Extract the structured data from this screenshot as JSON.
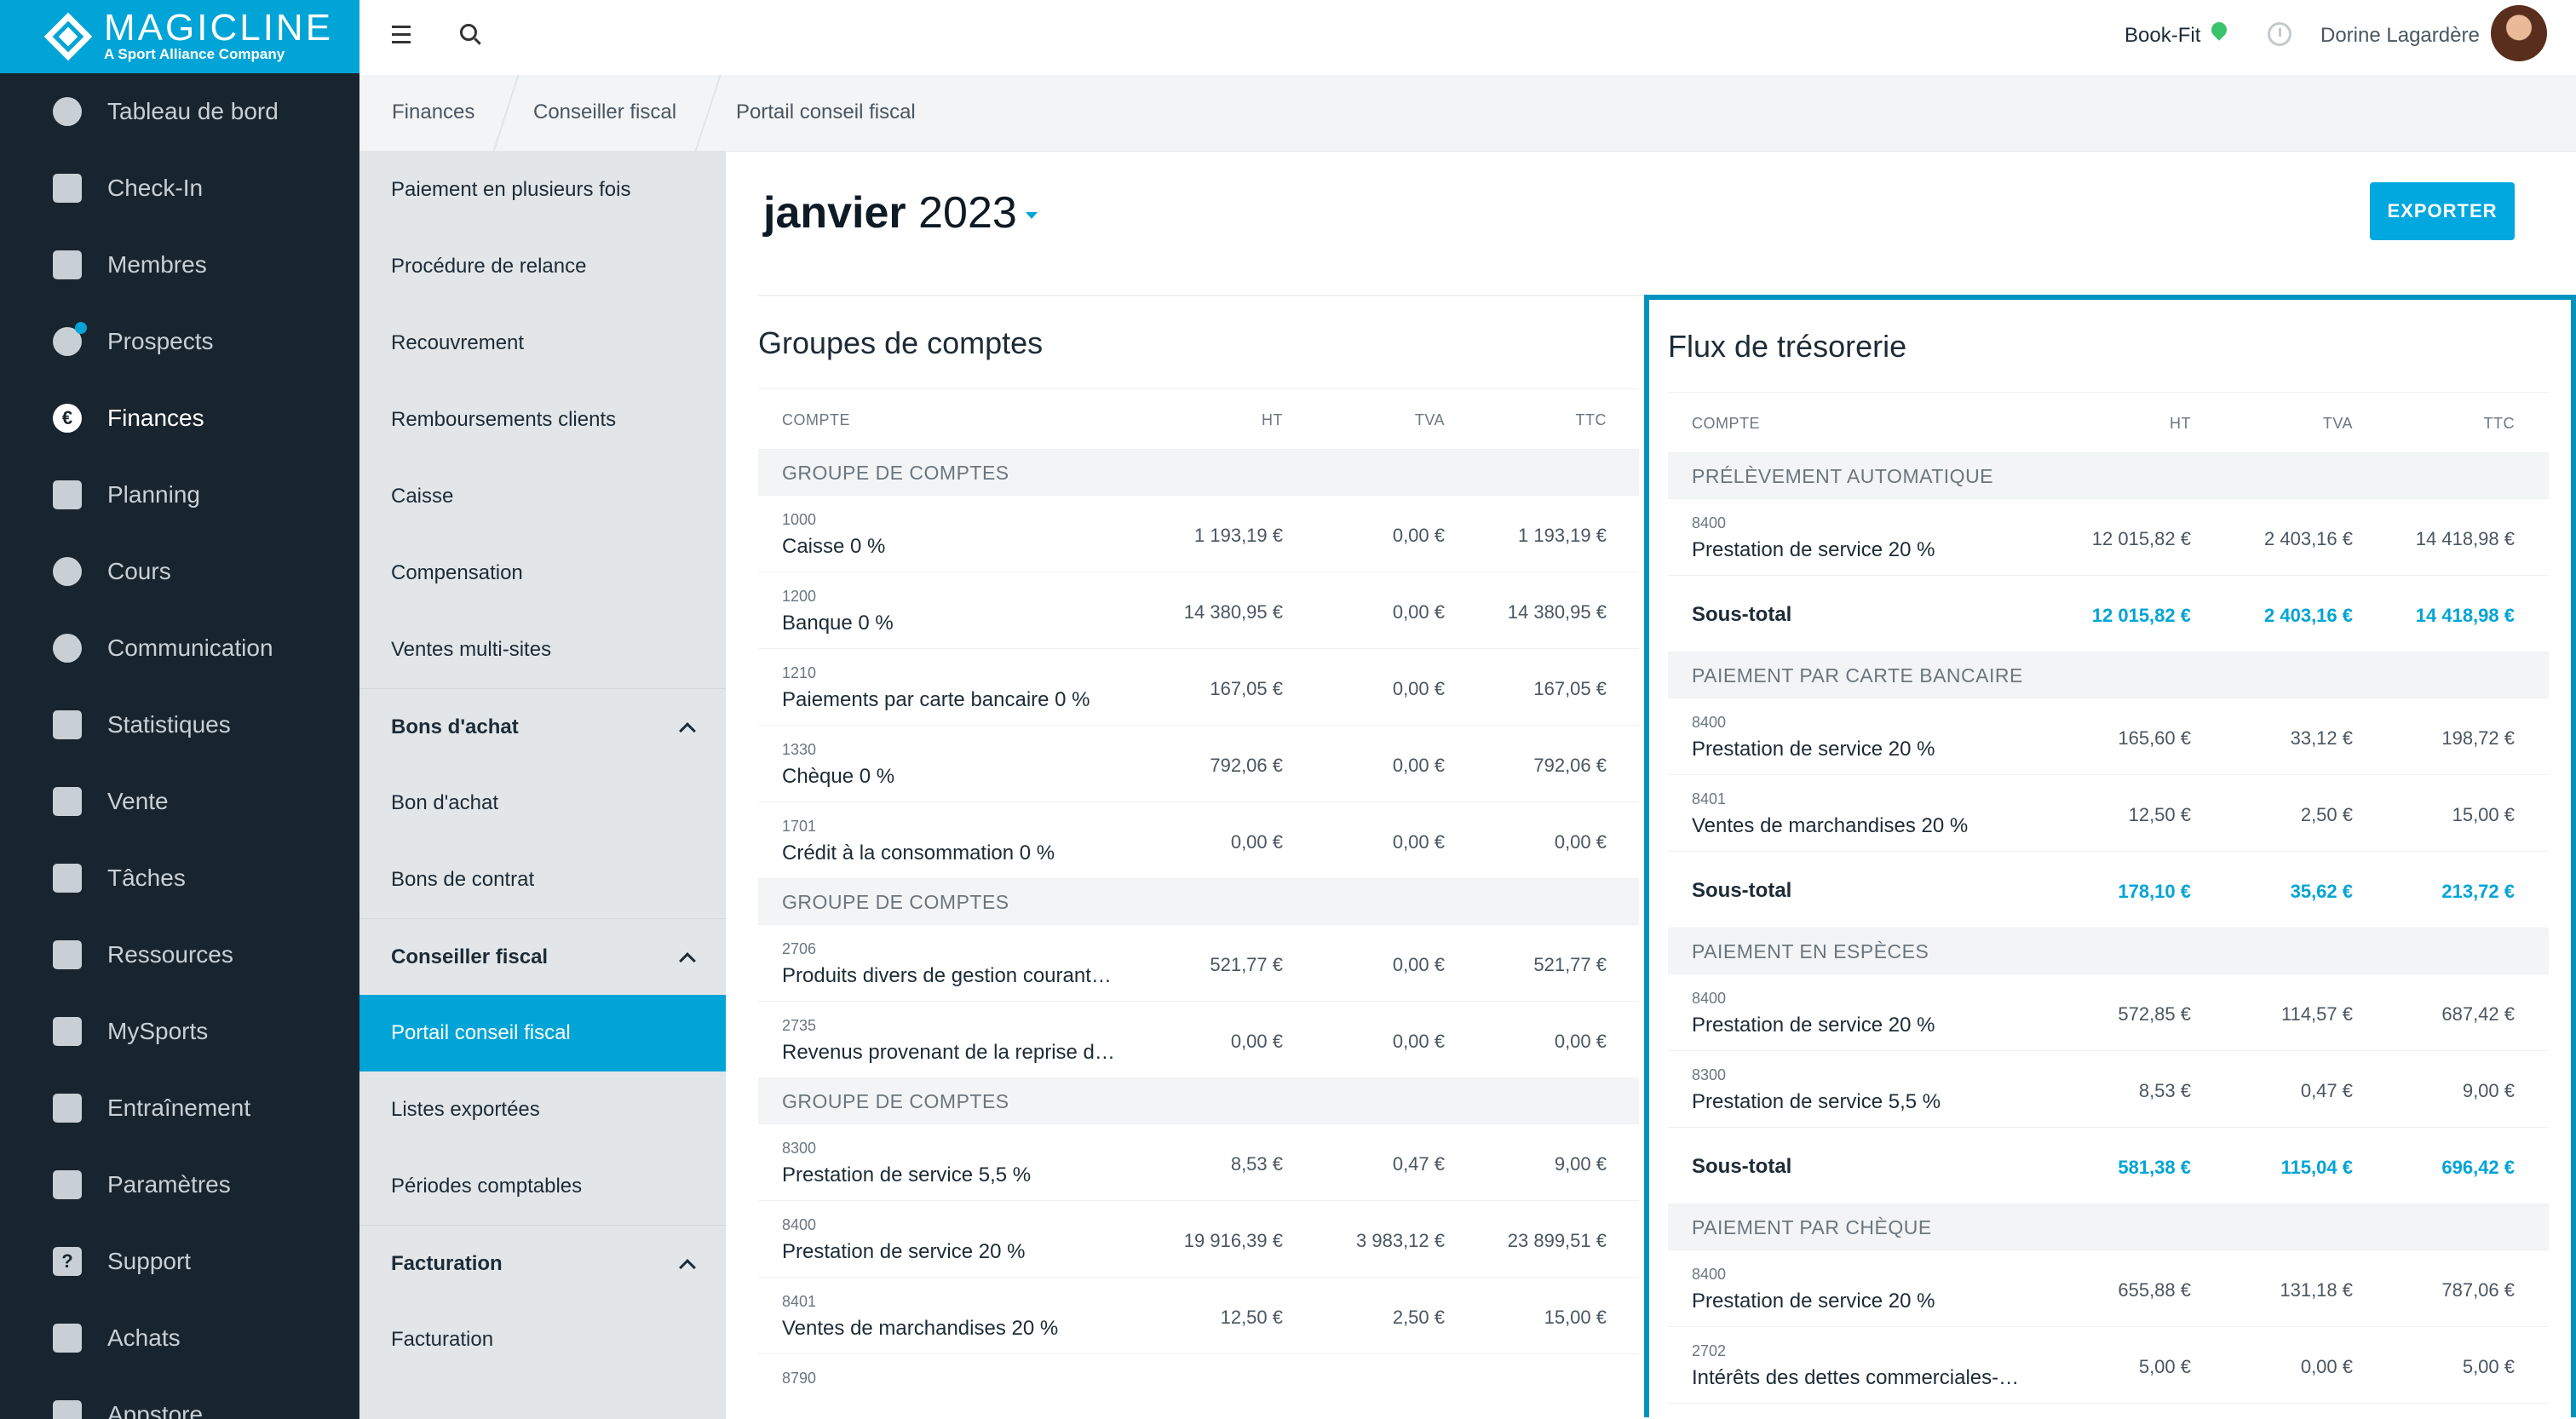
{
  "app": {
    "logo_name": "MAGICLINE",
    "logo_tagline": "A Sport Alliance Company"
  },
  "nav": [
    {
      "label": "Tableau de bord",
      "icon": "dashboard-icon"
    },
    {
      "label": "Check-In",
      "icon": "check-in-icon"
    },
    {
      "label": "Membres",
      "icon": "members-icon"
    },
    {
      "label": "Prospects",
      "icon": "prospects-icon"
    },
    {
      "label": "Finances",
      "icon": "euro-icon",
      "active": true
    },
    {
      "label": "Planning",
      "icon": "calendar-icon"
    },
    {
      "label": "Cours",
      "icon": "stopwatch-icon"
    },
    {
      "label": "Communication",
      "icon": "chat-icon"
    },
    {
      "label": "Statistiques",
      "icon": "chart-icon"
    },
    {
      "label": "Vente",
      "icon": "cart-icon"
    },
    {
      "label": "Tâches",
      "icon": "checkbox-icon"
    },
    {
      "label": "Ressources",
      "icon": "people-icon"
    },
    {
      "label": "MySports",
      "icon": "grid-dots-icon"
    },
    {
      "label": "Entraînement",
      "icon": "dumbbell-icon"
    },
    {
      "label": "Paramètres",
      "icon": "sliders-icon"
    },
    {
      "label": "Support",
      "icon": "help-icon"
    },
    {
      "label": "Achats",
      "icon": "bag-icon"
    },
    {
      "label": "Appstore",
      "icon": "apps-icon"
    }
  ],
  "topbar": {
    "studio": "Book-Fit",
    "user": "Dorine Lagardère"
  },
  "breadcrumb": [
    "Finances",
    "Conseiller fiscal",
    "Portail conseil fiscal"
  ],
  "subnav": [
    {
      "label": "Paiement en plusieurs fois"
    },
    {
      "label": "Procédure de relance"
    },
    {
      "label": "Recouvrement"
    },
    {
      "label": "Remboursements clients"
    },
    {
      "label": "Caisse"
    },
    {
      "label": "Compensation"
    },
    {
      "label": "Ventes multi-sites"
    },
    {
      "label": "Bons d'achat",
      "group": true
    },
    {
      "label": "Bon d'achat"
    },
    {
      "label": "Bons de contrat"
    },
    {
      "label": "Conseiller fiscal",
      "group": true
    },
    {
      "label": "Portail conseil fiscal",
      "active": true
    },
    {
      "label": "Listes exportées"
    },
    {
      "label": "Périodes comptables"
    },
    {
      "label": "Facturation",
      "group": true
    },
    {
      "label": "Facturation"
    }
  ],
  "page": {
    "month": "janvier",
    "year": "2023",
    "export_label": "EXPORTER"
  },
  "columns": [
    "COMPTE",
    "HT",
    "TVA",
    "TTC"
  ],
  "account_groups": {
    "title": "Groupes de comptes",
    "groups": [
      {
        "label": "GROUPE DE COMPTES",
        "rows": [
          {
            "code": "1000",
            "name": "Caisse 0 %",
            "ht": "1 193,19 €",
            "tva": "0,00 €",
            "ttc": "1 193,19 €"
          },
          {
            "code": "1200",
            "name": "Banque 0 %",
            "ht": "14 380,95 €",
            "tva": "0,00 €",
            "ttc": "14 380,95 €"
          },
          {
            "code": "1210",
            "name": "Paiements par carte bancaire 0 %",
            "ht": "167,05 €",
            "tva": "0,00 €",
            "ttc": "167,05 €"
          },
          {
            "code": "1330",
            "name": "Chèque 0 %",
            "ht": "792,06 €",
            "tva": "0,00 €",
            "ttc": "792,06 €"
          },
          {
            "code": "1701",
            "name": "Crédit à la consommation 0 %",
            "ht": "0,00 €",
            "tva": "0,00 €",
            "ttc": "0,00 €"
          }
        ]
      },
      {
        "label": "GROUPE DE COMPTES",
        "rows": [
          {
            "code": "2706",
            "name": "Produits divers de gestion courant…",
            "ht": "521,77 €",
            "tva": "0,00 €",
            "ttc": "521,77 €"
          },
          {
            "code": "2735",
            "name": "Revenus provenant de la reprise de…",
            "ht": "0,00 €",
            "tva": "0,00 €",
            "ttc": "0,00 €"
          }
        ]
      },
      {
        "label": "GROUPE DE COMPTES",
        "rows": [
          {
            "code": "8300",
            "name": "Prestation de service 5,5 %",
            "ht": "8,53 €",
            "tva": "0,47 €",
            "ttc": "9,00 €"
          },
          {
            "code": "8400",
            "name": "Prestation de service 20 %",
            "ht": "19 916,39 €",
            "tva": "3 983,12 €",
            "ttc": "23 899,51 €"
          },
          {
            "code": "8401",
            "name": "Ventes de marchandises 20 %",
            "ht": "12,50 €",
            "tva": "2,50 €",
            "ttc": "15,00 €"
          },
          {
            "code": "8790",
            "name": "",
            "ht": "",
            "tva": "",
            "ttc": ""
          }
        ]
      }
    ]
  },
  "cash_flow": {
    "title": "Flux de trésorerie",
    "subtotal_label": "Sous-total",
    "groups": [
      {
        "label": "PRÉLÈVEMENT AUTOMATIQUE",
        "rows": [
          {
            "code": "8400",
            "name": "Prestation de service 20 %",
            "ht": "12 015,82 €",
            "tva": "2 403,16 €",
            "ttc": "14 418,98 €"
          }
        ],
        "subtotal": {
          "ht": "12 015,82 €",
          "tva": "2 403,16 €",
          "ttc": "14 418,98 €"
        }
      },
      {
        "label": "PAIEMENT PAR CARTE BANCAIRE",
        "rows": [
          {
            "code": "8400",
            "name": "Prestation de service 20 %",
            "ht": "165,60 €",
            "tva": "33,12 €",
            "ttc": "198,72 €"
          },
          {
            "code": "8401",
            "name": "Ventes de marchandises 20 %",
            "ht": "12,50 €",
            "tva": "2,50 €",
            "ttc": "15,00 €"
          }
        ],
        "subtotal": {
          "ht": "178,10 €",
          "tva": "35,62 €",
          "ttc": "213,72 €"
        }
      },
      {
        "label": "PAIEMENT EN ESPÈCES",
        "rows": [
          {
            "code": "8400",
            "name": "Prestation de service 20 %",
            "ht": "572,85 €",
            "tva": "114,57 €",
            "ttc": "687,42 €"
          },
          {
            "code": "8300",
            "name": "Prestation de service 5,5 %",
            "ht": "8,53 €",
            "tva": "0,47 €",
            "ttc": "9,00 €"
          }
        ],
        "subtotal": {
          "ht": "581,38 €",
          "tva": "115,04 €",
          "ttc": "696,42 €"
        }
      },
      {
        "label": "PAIEMENT PAR CHÈQUE",
        "rows": [
          {
            "code": "8400",
            "name": "Prestation de service 20 %",
            "ht": "655,88 €",
            "tva": "131,18 €",
            "ttc": "787,06 €"
          },
          {
            "code": "2702",
            "name": "Intérêts des dettes commerciales-E…",
            "ht": "5,00 €",
            "tva": "0,00 €",
            "ttc": "5,00 €"
          }
        ]
      }
    ]
  }
}
